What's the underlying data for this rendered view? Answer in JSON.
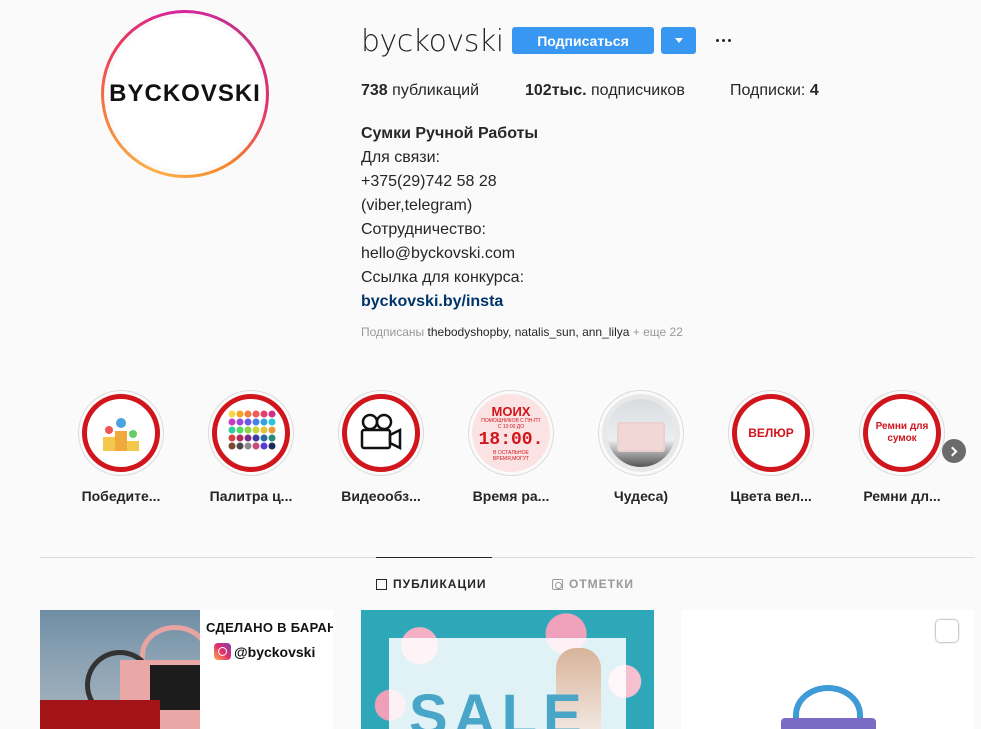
{
  "profile": {
    "avatar_text": "BYCKOVSKI",
    "username": "byckovski",
    "follow_label": "Подписаться",
    "stats": {
      "posts_count": "738",
      "posts_label": "публикаций",
      "followers_count": "102тыс.",
      "followers_label": "подписчиков",
      "following_label": "Подписки:",
      "following_count": "4"
    },
    "bio": {
      "name": "Сумки Ручной Работы",
      "lines": [
        "Для связи:",
        "+375(29)742 58 28",
        "(viber,telegram)",
        "Сотрудничество:",
        "hello@byckovski.com",
        "Ссылка для конкурса:"
      ],
      "link": "byckovski.by/insta"
    },
    "followed_by": {
      "prefix": "Подписаны",
      "users": "thebodyshopby, natalis_sun, ann_lilya",
      "more": "+ еще 22"
    }
  },
  "highlights": [
    {
      "label": "Победите...",
      "cover": "podium-image"
    },
    {
      "label": "Палитра ц...",
      "cover": "color-palette-image"
    },
    {
      "label": "Видеообз...",
      "cover": "video-camera-image"
    },
    {
      "label": "Время ра...",
      "cover_top": "МОИХ",
      "cover_small": "ПОМОЩНИКОВ С ПН-ПТ С 10:00 ДО",
      "cover_time": "18:00.",
      "cover_bottom": "В ОСТАЛЬНОЕ ВРЕМЯ,МОГУТ"
    },
    {
      "label": "Чудеса)",
      "cover": "bag-photo"
    },
    {
      "label": "Цвета вел...",
      "cover_text": "ВЕЛЮР"
    },
    {
      "label": "Ремни дл...",
      "cover_text": "Ремни для сумок"
    }
  ],
  "tabs": {
    "posts": "ПУБЛИКАЦИИ",
    "tagged": "ОТМЕТКИ"
  },
  "posts": {
    "post1": {
      "banner_text": "СДЕЛАНО В БАРАНОВ",
      "handle": "@byckovski"
    },
    "post2": {
      "overlay_text": "SALE"
    }
  }
}
